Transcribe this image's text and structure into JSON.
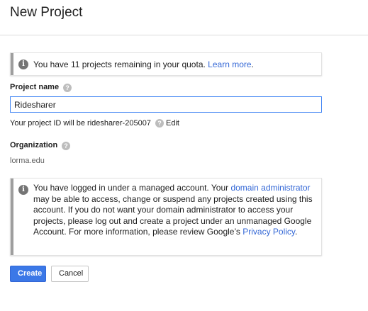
{
  "header": {
    "title": "New Project"
  },
  "quota_notice": {
    "text": "You have 11 projects remaining in your quota. ",
    "link": "Learn more",
    "after": "."
  },
  "project_name": {
    "label": "Project name",
    "value": "Ridesharer",
    "id_prefix": "Your project ID will be ridesharer-205007",
    "edit_link": "Edit"
  },
  "organization": {
    "label": "Organization",
    "value": "lorma.edu"
  },
  "managed_notice": {
    "text1": "You have logged in under a managed account. Your ",
    "link1": "domain administrator",
    "text2": " may be able to access, change or suspend any projects created using this account. If you do not want your domain administrator to access your projects, please log out and create a project under an unmanaged Google Account. For more information, please review Google’s ",
    "link2": "Privacy Policy",
    "text3": "."
  },
  "actions": {
    "create": "Create",
    "cancel": "Cancel"
  },
  "icons": {
    "info": "info-icon",
    "help": "help-icon"
  },
  "colors": {
    "primary": "#3b78e7",
    "link": "#3367d6",
    "input_border": "#4285f4"
  }
}
